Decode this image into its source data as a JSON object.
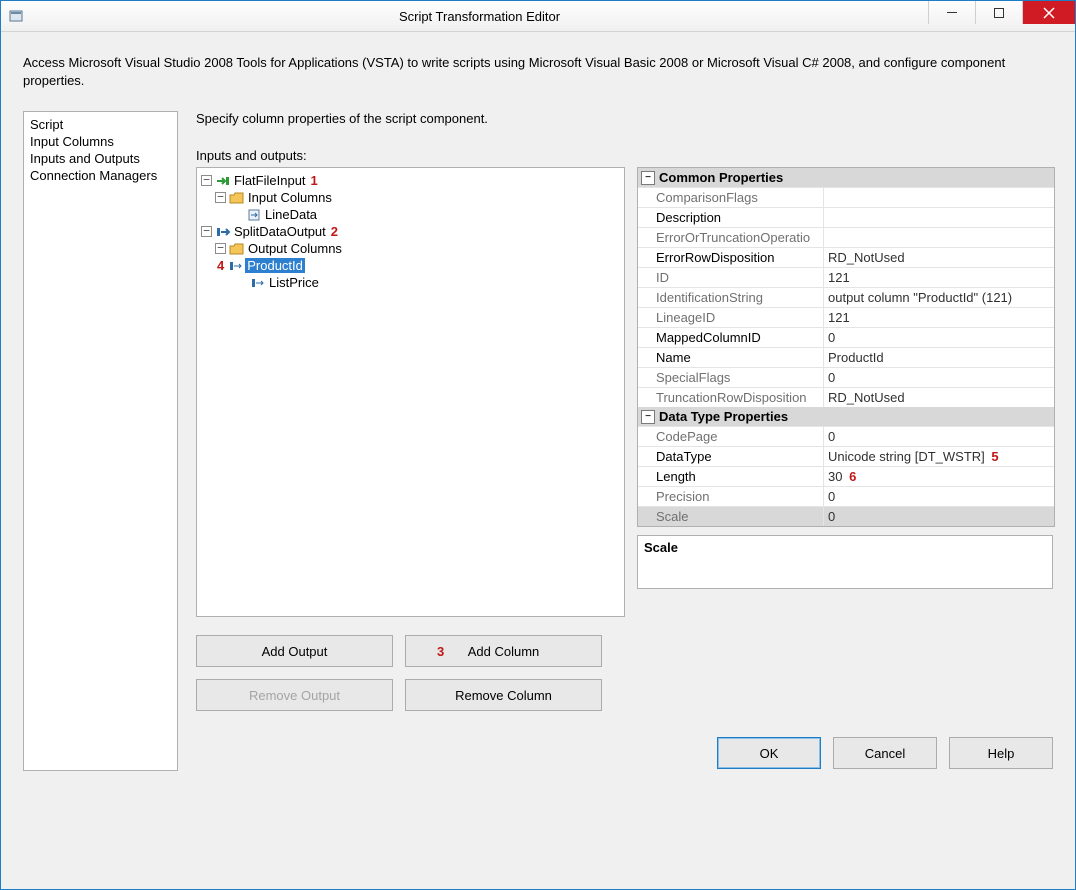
{
  "window": {
    "title": "Script Transformation Editor"
  },
  "description": "Access Microsoft Visual Studio 2008 Tools for Applications (VSTA) to write scripts using Microsoft Visual Basic 2008 or Microsoft Visual C# 2008, and configure component properties.",
  "nav": {
    "items": [
      "Script",
      "Input Columns",
      "Inputs and Outputs",
      "Connection Managers"
    ],
    "selected_index": 2
  },
  "main": {
    "heading": "Specify column properties of the script component.",
    "io_label": "Inputs and outputs:"
  },
  "tree": {
    "root": [
      {
        "label": "FlatFileInput",
        "type": "input-arrow-green",
        "expanded": true,
        "annot": "1",
        "children": [
          {
            "label": "Input Columns",
            "type": "folder",
            "expanded": true,
            "children": [
              {
                "label": "LineData",
                "type": "column-in"
              }
            ]
          }
        ]
      },
      {
        "label": "SplitDataOutput",
        "type": "output-arrow-blue",
        "expanded": true,
        "annot": "2",
        "children": [
          {
            "label": "Output Columns",
            "type": "folder",
            "expanded": true,
            "children": [
              {
                "label": "ProductId",
                "type": "column-out",
                "selected": true,
                "annot_left": "4"
              },
              {
                "label": "ListPrice",
                "type": "column-out"
              }
            ]
          }
        ]
      }
    ]
  },
  "propgrid": {
    "categories": [
      {
        "name": "Common Properties",
        "rows": [
          {
            "name": "ComparisonFlags",
            "value": "",
            "readonly": true
          },
          {
            "name": "Description",
            "value": "",
            "readonly": false
          },
          {
            "name": "ErrorOrTruncationOperatio",
            "value": "",
            "readonly": true
          },
          {
            "name": "ErrorRowDisposition",
            "value": "RD_NotUsed",
            "readonly": false
          },
          {
            "name": "ID",
            "value": "121",
            "readonly": true
          },
          {
            "name": "IdentificationString",
            "value": "output column \"ProductId\" (121)",
            "readonly": true
          },
          {
            "name": "LineageID",
            "value": "121",
            "readonly": true
          },
          {
            "name": "MappedColumnID",
            "value": "0",
            "readonly": false
          },
          {
            "name": "Name",
            "value": "ProductId",
            "readonly": false
          },
          {
            "name": "SpecialFlags",
            "value": "0",
            "readonly": true
          },
          {
            "name": "TruncationRowDisposition",
            "value": "RD_NotUsed",
            "readonly": true
          }
        ]
      },
      {
        "name": "Data Type Properties",
        "rows": [
          {
            "name": "CodePage",
            "value": "0",
            "readonly": true
          },
          {
            "name": "DataType",
            "value": "Unicode string [DT_WSTR]",
            "readonly": false,
            "annot": "5"
          },
          {
            "name": "Length",
            "value": "30",
            "readonly": false,
            "annot": "6"
          },
          {
            "name": "Precision",
            "value": "0",
            "readonly": true
          },
          {
            "name": "Scale",
            "value": "0",
            "readonly": true,
            "selected": true
          }
        ]
      }
    ],
    "help_title": "Scale"
  },
  "buttons": {
    "add_output": "Add Output",
    "add_column": "Add Column",
    "add_column_annot": "3",
    "remove_output": "Remove Output",
    "remove_column": "Remove Column"
  },
  "footer": {
    "ok": "OK",
    "cancel": "Cancel",
    "help": "Help"
  }
}
